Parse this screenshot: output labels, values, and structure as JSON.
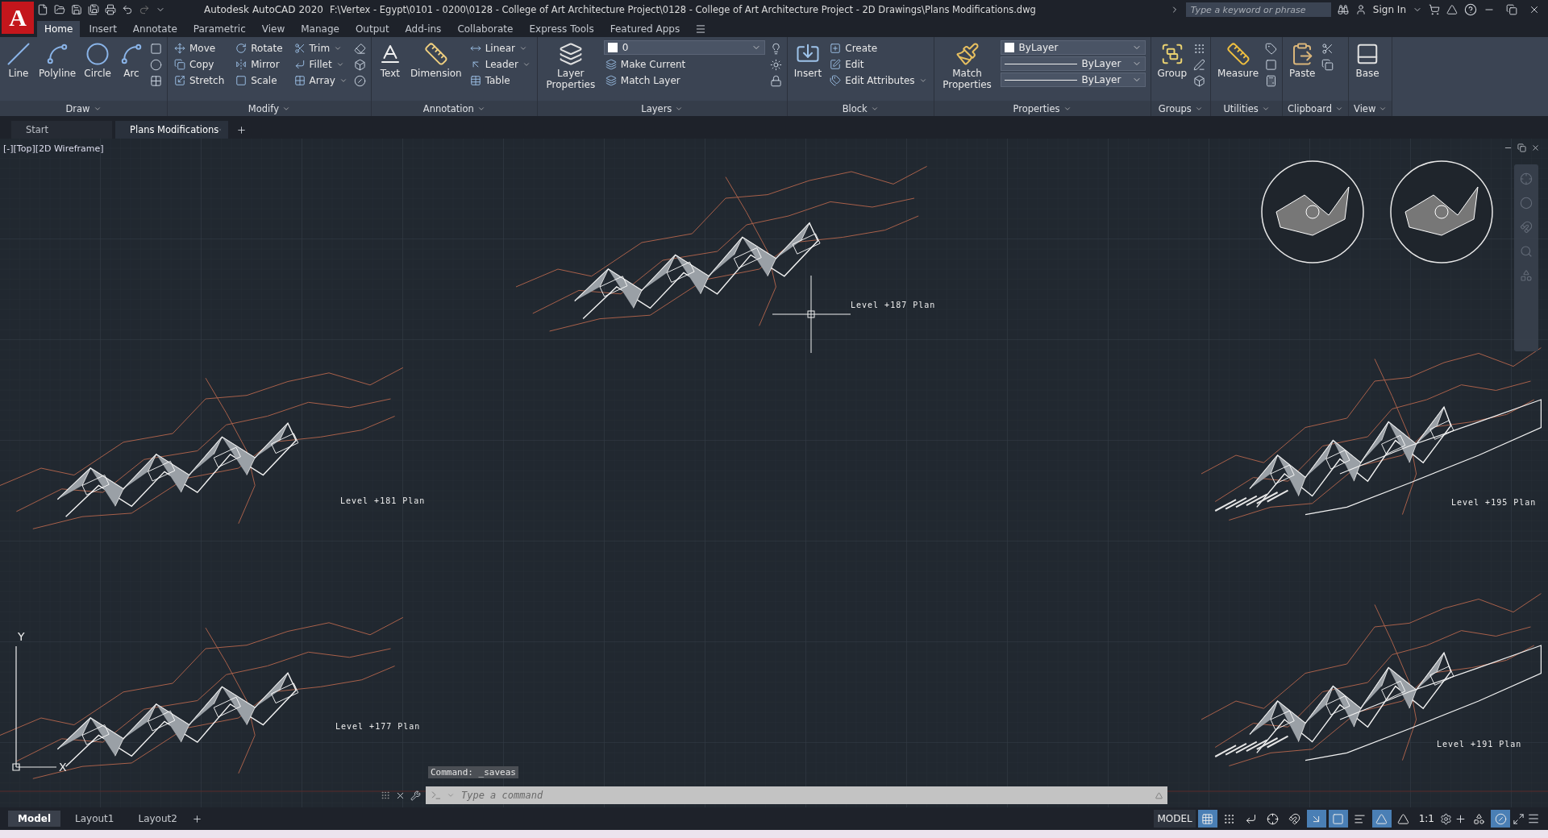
{
  "app": {
    "logo": "A",
    "title": "Autodesk AutoCAD 2020",
    "file_path": "F:\\Vertex - Egypt\\0101 - 0200\\0128 - College of Art Architecture Project\\0128 - College of Art Architecture Project - 2D Drawings\\Plans Modifications.dwg",
    "search_placeholder": "Type a keyword or phrase",
    "sign_in": "Sign In"
  },
  "ribbon_tabs": [
    {
      "label": "Home",
      "selected": true
    },
    {
      "label": "Insert",
      "selected": false
    },
    {
      "label": "Annotate",
      "selected": false
    },
    {
      "label": "Parametric",
      "selected": false
    },
    {
      "label": "View",
      "selected": false
    },
    {
      "label": "Manage",
      "selected": false
    },
    {
      "label": "Output",
      "selected": false
    },
    {
      "label": "Add-ins",
      "selected": false
    },
    {
      "label": "Collaborate",
      "selected": false
    },
    {
      "label": "Express Tools",
      "selected": false
    },
    {
      "label": "Featured Apps",
      "selected": false
    }
  ],
  "panels": [
    {
      "title": "Draw",
      "tools": [
        {
          "kind": "large",
          "label": "Line"
        },
        {
          "kind": "large",
          "label": "Polyline"
        },
        {
          "kind": "large",
          "label": "Circle"
        },
        {
          "kind": "large",
          "label": "Arc"
        }
      ]
    },
    {
      "title": "Modify",
      "tools": [
        {
          "kind": "small",
          "label": "Move",
          "dropdown": false
        },
        {
          "kind": "small",
          "label": "Copy",
          "dropdown": false
        },
        {
          "kind": "small",
          "label": "Stretch",
          "dropdown": false
        },
        {
          "kind": "small",
          "label": "Rotate",
          "dropdown": false
        },
        {
          "kind": "small",
          "label": "Mirror",
          "dropdown": false
        },
        {
          "kind": "small",
          "label": "Scale",
          "dropdown": false
        },
        {
          "kind": "small",
          "label": "Trim",
          "dropdown": true
        },
        {
          "kind": "small",
          "label": "Fillet",
          "dropdown": true
        },
        {
          "kind": "small",
          "label": "Array",
          "dropdown": true
        }
      ]
    },
    {
      "title": "Annotation",
      "tools": [
        {
          "kind": "large",
          "label": "Text"
        },
        {
          "kind": "large",
          "label": "Dimension"
        },
        {
          "kind": "small",
          "label": "Linear",
          "dropdown": true
        },
        {
          "kind": "small",
          "label": "Leader",
          "dropdown": true
        },
        {
          "kind": "small",
          "label": "Table",
          "dropdown": false
        }
      ]
    },
    {
      "title": "Layers",
      "tools": [
        {
          "kind": "large",
          "label": "Layer Properties"
        },
        {
          "kind": "colorselect",
          "value": "0"
        },
        {
          "kind": "small",
          "label": "Make Current",
          "dropdown": false
        },
        {
          "kind": "small",
          "label": "Match Layer",
          "dropdown": false
        }
      ]
    },
    {
      "title": "Block",
      "tools": [
        {
          "kind": "large",
          "label": "Insert"
        },
        {
          "kind": "small",
          "label": "Create",
          "dropdown": false
        },
        {
          "kind": "small",
          "label": "Edit",
          "dropdown": false
        },
        {
          "kind": "small",
          "label": "Edit Attributes",
          "dropdown": true
        }
      ]
    },
    {
      "title": "Properties",
      "tools": [
        {
          "kind": "large",
          "label": "Match Properties"
        },
        {
          "kind": "colorselect",
          "value": "ByLayer"
        },
        {
          "kind": "lineselect",
          "value": "ByLayer"
        },
        {
          "kind": "lineselect",
          "value": "ByLayer"
        }
      ]
    },
    {
      "title": "Groups",
      "tools": [
        {
          "kind": "large",
          "label": "Group"
        }
      ]
    },
    {
      "title": "Utilities",
      "tools": [
        {
          "kind": "large",
          "label": "Measure"
        }
      ]
    },
    {
      "title": "Clipboard",
      "tools": [
        {
          "kind": "large",
          "label": "Paste"
        }
      ]
    },
    {
      "title": "View",
      "tools": [
        {
          "kind": "large",
          "label": "Base"
        }
      ]
    }
  ],
  "doc_tabs": [
    {
      "label": "Start",
      "selected": false
    },
    {
      "label": "Plans Modifications",
      "selected": true
    }
  ],
  "viewport": {
    "label": "[-][Top][2D Wireframe]",
    "ucs_y": "Y",
    "ucs_x": "X"
  },
  "drawings": [
    {
      "label": "Level +187 Plan"
    },
    {
      "label": "Level +181 Plan"
    },
    {
      "label": "Level +177 Plan"
    },
    {
      "label": "Level +195 Plan"
    },
    {
      "label": "Level +191 Plan"
    }
  ],
  "command": {
    "history": "Command: _saveas",
    "placeholder": "Type a command"
  },
  "layout_tabs": [
    {
      "label": "Model",
      "selected": true
    },
    {
      "label": "Layout1",
      "selected": false
    },
    {
      "label": "Layout2",
      "selected": false
    }
  ],
  "status": {
    "model": "MODEL",
    "annotation_scale": "1:1",
    "toggles": [
      {
        "on": true
      },
      {
        "on": false
      },
      {
        "on": false
      },
      {
        "on": false
      },
      {
        "on": false
      },
      {
        "on": true
      },
      {
        "on": true
      },
      {
        "on": false
      },
      {
        "on": true
      },
      {
        "on": false
      },
      {
        "on": false
      },
      {
        "on": true
      }
    ]
  }
}
